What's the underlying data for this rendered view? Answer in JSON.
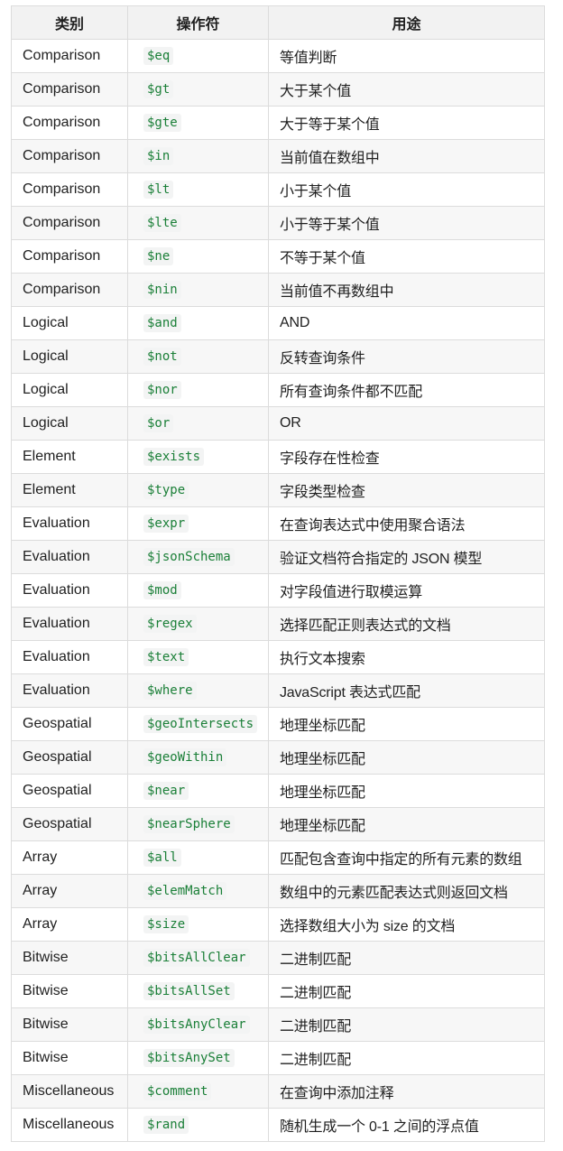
{
  "table": {
    "headers": [
      "类别",
      "操作符",
      "用途"
    ],
    "rows": [
      {
        "category": "Comparison",
        "operator": "$eq",
        "purpose": "等值判断"
      },
      {
        "category": "Comparison",
        "operator": "$gt",
        "purpose": "大于某个值"
      },
      {
        "category": "Comparison",
        "operator": "$gte",
        "purpose": "大于等于某个值"
      },
      {
        "category": "Comparison",
        "operator": "$in",
        "purpose": "当前值在数组中"
      },
      {
        "category": "Comparison",
        "operator": "$lt",
        "purpose": "小于某个值"
      },
      {
        "category": "Comparison",
        "operator": "$lte",
        "purpose": "小于等于某个值"
      },
      {
        "category": "Comparison",
        "operator": "$ne",
        "purpose": "不等于某个值"
      },
      {
        "category": "Comparison",
        "operator": "$nin",
        "purpose": "当前值不再数组中"
      },
      {
        "category": "Logical",
        "operator": "$and",
        "purpose": "AND"
      },
      {
        "category": "Logical",
        "operator": "$not",
        "purpose": "反转查询条件"
      },
      {
        "category": "Logical",
        "operator": "$nor",
        "purpose": "所有查询条件都不匹配"
      },
      {
        "category": "Logical",
        "operator": "$or",
        "purpose": "OR"
      },
      {
        "category": "Element",
        "operator": "$exists",
        "purpose": "字段存在性检查"
      },
      {
        "category": "Element",
        "operator": "$type",
        "purpose": "字段类型检查"
      },
      {
        "category": "Evaluation",
        "operator": "$expr",
        "purpose": "在查询表达式中使用聚合语法"
      },
      {
        "category": "Evaluation",
        "operator": "$jsonSchema",
        "purpose": "验证文档符合指定的 JSON 模型"
      },
      {
        "category": "Evaluation",
        "operator": "$mod",
        "purpose": "对字段值进行取模运算"
      },
      {
        "category": "Evaluation",
        "operator": "$regex",
        "purpose": "选择匹配正则表达式的文档"
      },
      {
        "category": "Evaluation",
        "operator": "$text",
        "purpose": "执行文本搜索"
      },
      {
        "category": "Evaluation",
        "operator": "$where",
        "purpose": "JavaScript 表达式匹配"
      },
      {
        "category": "Geospatial",
        "operator": "$geoIntersects",
        "purpose": "地理坐标匹配"
      },
      {
        "category": "Geospatial",
        "operator": "$geoWithin",
        "purpose": "地理坐标匹配"
      },
      {
        "category": "Geospatial",
        "operator": "$near",
        "purpose": "地理坐标匹配"
      },
      {
        "category": "Geospatial",
        "operator": "$nearSphere",
        "purpose": "地理坐标匹配"
      },
      {
        "category": "Array",
        "operator": "$all",
        "purpose": "匹配包含查询中指定的所有元素的数组"
      },
      {
        "category": "Array",
        "operator": "$elemMatch",
        "purpose": "数组中的元素匹配表达式则返回文档"
      },
      {
        "category": "Array",
        "operator": "$size",
        "purpose": "选择数组大小为 size 的文档"
      },
      {
        "category": "Bitwise",
        "operator": "$bitsAllClear",
        "purpose": "二进制匹配"
      },
      {
        "category": "Bitwise",
        "operator": "$bitsAllSet",
        "purpose": "二进制匹配"
      },
      {
        "category": "Bitwise",
        "operator": "$bitsAnyClear",
        "purpose": "二进制匹配"
      },
      {
        "category": "Bitwise",
        "operator": "$bitsAnySet",
        "purpose": "二进制匹配"
      },
      {
        "category": "Miscellaneous",
        "operator": "$comment",
        "purpose": "在查询中添加注释"
      },
      {
        "category": "Miscellaneous",
        "operator": "$rand",
        "purpose": "随机生成一个 0-1 之间的浮点值"
      }
    ]
  }
}
